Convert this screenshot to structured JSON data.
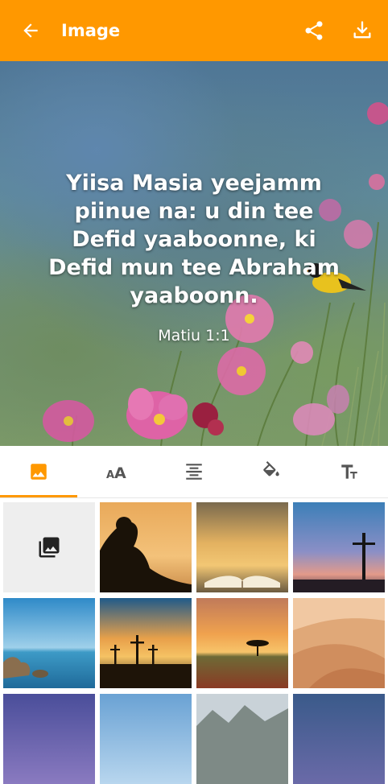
{
  "app_bar": {
    "title": "Image",
    "back_icon": "arrow-back-icon",
    "share_icon": "share-icon",
    "download_icon": "download-icon",
    "color": "#ff9800"
  },
  "preview": {
    "verse_lines": [
      "Yiisa Masia yeejamm",
      "piinue na: u din tee",
      "Defid yaaboonne, ki",
      "Defid mun tee Abraham",
      "yaaboonn."
    ],
    "reference": "Matiu 1:1"
  },
  "tool_tabs": [
    {
      "name": "background-image",
      "icon": "image-icon",
      "active": true
    },
    {
      "name": "font-size",
      "icon": "text-size-icon",
      "active": false
    },
    {
      "name": "alignment",
      "icon": "align-center-icon",
      "active": false
    },
    {
      "name": "color",
      "icon": "paint-bucket-icon",
      "active": false
    },
    {
      "name": "font-style",
      "icon": "text-format-icon",
      "active": false
    }
  ],
  "image_grid": {
    "picker_icon": "photo-library-icon",
    "thumbnails": [
      "silhouette-reading-sunset",
      "open-bible-sunset",
      "cross-sunset",
      "sea-rocks",
      "three-crosses-sunset",
      "savanna-tree-sunset",
      "desert-dunes",
      "purple-sky",
      "blue-sky",
      "mountains",
      "dusk-sky"
    ]
  }
}
